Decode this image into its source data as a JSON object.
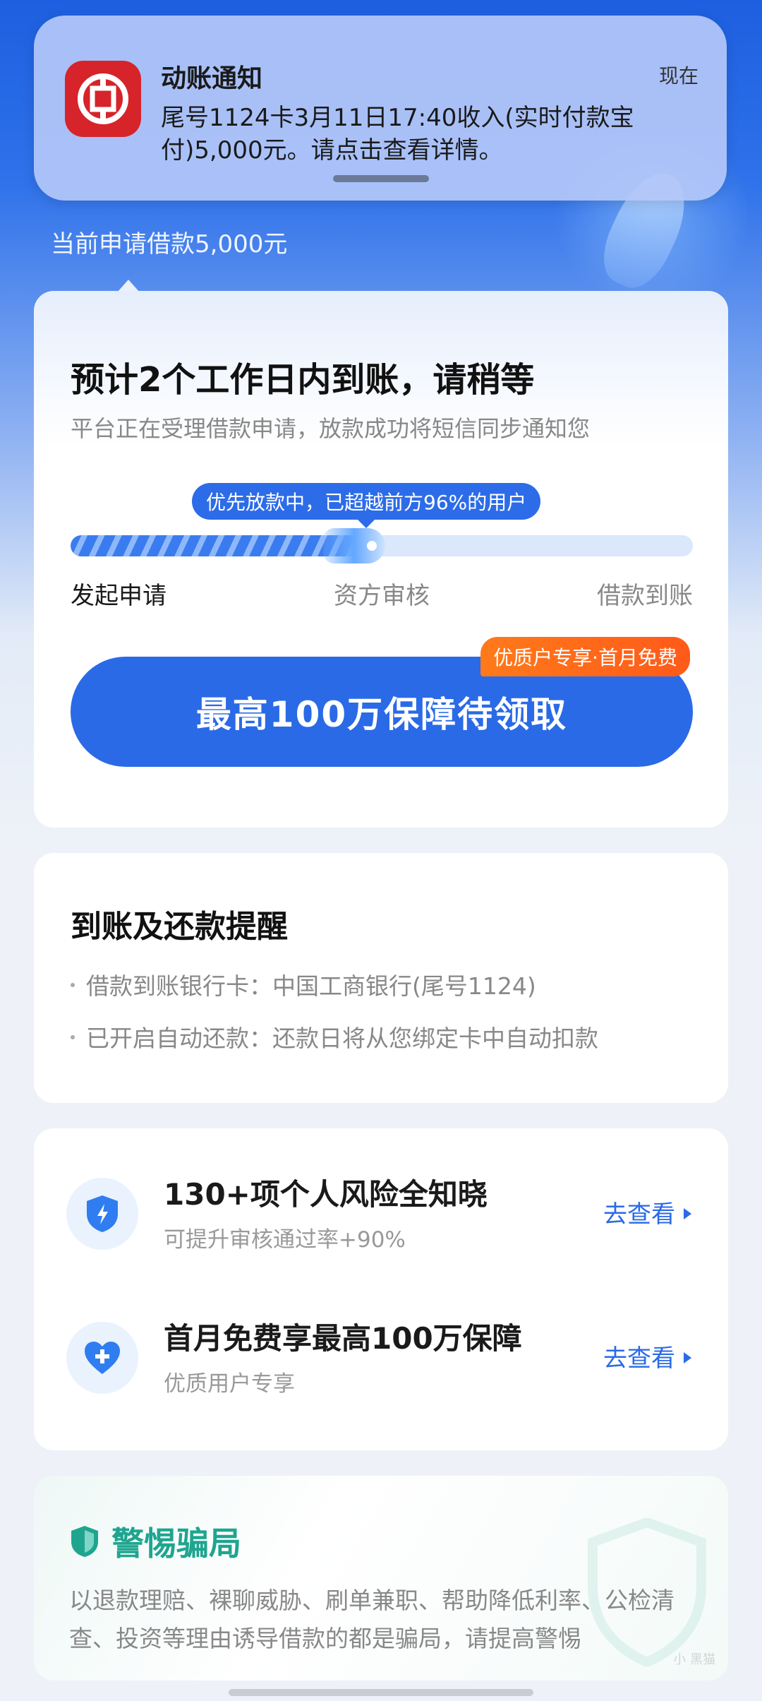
{
  "notification": {
    "title": "动账通知",
    "time": "现在",
    "body": "尾号1124卡3月11日17:40收入(实时付款宝付)5,000元。请点击查看详情。"
  },
  "apply_text": "当前申请借款5,000元",
  "status_card": {
    "heading": "预计2个工作日内到账，请稍等",
    "subtitle": "平台正在受理借款申请，放款成功将短信同步通知您",
    "progress_tip": "优先放款中，已超越前方96%的用户",
    "progress_fraction": 0.49,
    "steps": [
      "发起申请",
      "资方审核",
      "借款到账"
    ],
    "promo_badge": "优质户专享·首月免费",
    "cta_label": "最高100万保障待领取"
  },
  "reminder_card": {
    "heading": "到账及还款提醒",
    "lines": [
      "借款到账银行卡：中国工商银行(尾号1124)",
      "已开启自动还款：还款日将从您绑定卡中自动扣款"
    ]
  },
  "services": [
    {
      "icon": "lightning-shield-icon",
      "title": "130+项个人风险全知晓",
      "desc": "可提升审核通过率+90%",
      "action": "去查看"
    },
    {
      "icon": "heart-plus-icon",
      "title": "首月免费享最高100万保障",
      "desc": "优质用户专享",
      "action": "去查看"
    }
  ],
  "warning_card": {
    "heading": "警惕骗局",
    "body": "以退款理赔、裸聊威胁、刷单兼职、帮助降低利率、公检清查、投资等理由诱导借款的都是骗局，请提高警惕"
  },
  "watermark": "小 黑猫",
  "colors": {
    "primary": "#2a6ae6",
    "promo": "#ff6a1a",
    "safe": "#1fa58f",
    "bank_red": "#d6242a"
  }
}
